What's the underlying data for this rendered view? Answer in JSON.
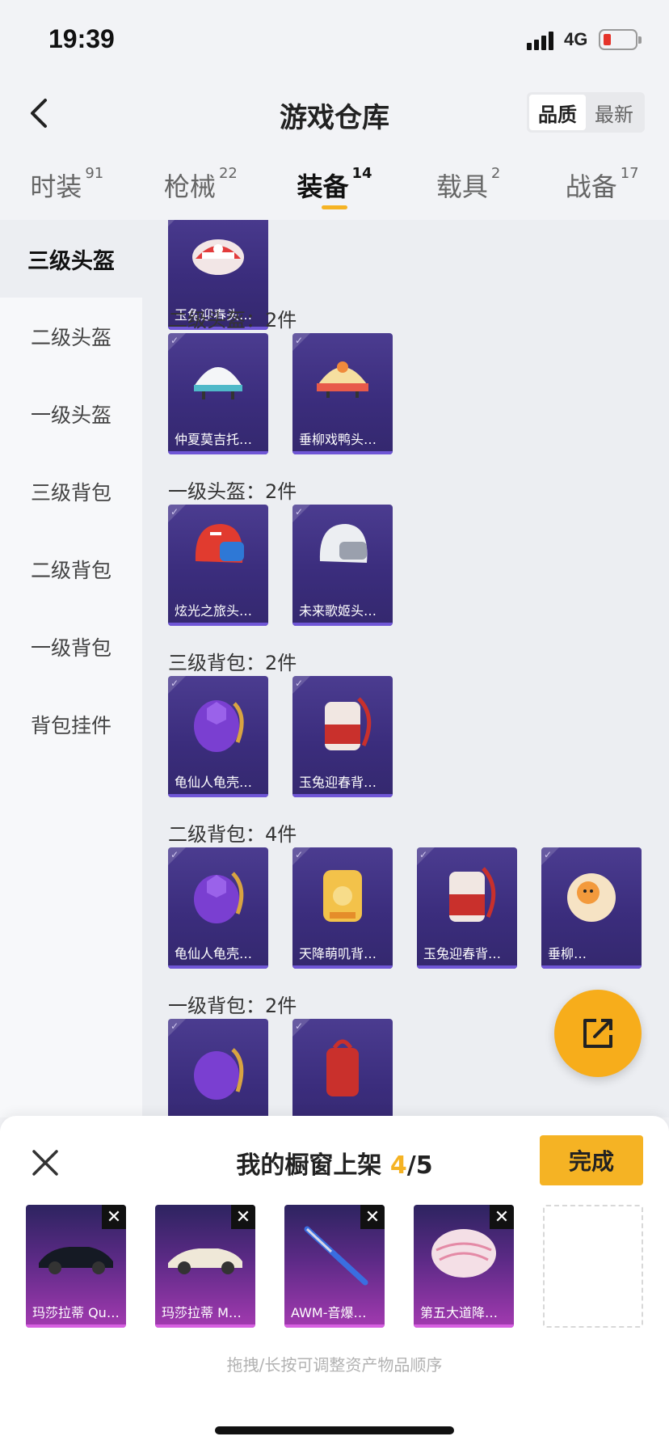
{
  "status": {
    "time": "19:39",
    "network": "4G"
  },
  "header": {
    "title": "游戏仓库",
    "sort": [
      "品质",
      "最新"
    ]
  },
  "tabs": [
    {
      "label": "时装",
      "count": "91"
    },
    {
      "label": "枪械",
      "count": "22"
    },
    {
      "label": "装备",
      "count": "14"
    },
    {
      "label": "载具",
      "count": "2"
    },
    {
      "label": "战备",
      "count": "17"
    }
  ],
  "sidebar": [
    "三级头盔",
    "二级头盔",
    "一级头盔",
    "三级背包",
    "二级背包",
    "一级背包",
    "背包挂件"
  ],
  "sections": [
    {
      "label": "",
      "items": [
        "玉兔迎春头…"
      ]
    },
    {
      "label": "二级头盔：2件",
      "items": [
        "仲夏莫吉托…",
        "垂柳戏鸭头…"
      ]
    },
    {
      "label": "一级头盔：2件",
      "items": [
        "炫光之旅头…",
        "未来歌姬头…"
      ]
    },
    {
      "label": "三级背包：2件",
      "items": [
        "龟仙人龟壳…",
        "玉兔迎春背…"
      ]
    },
    {
      "label": "二级背包：4件",
      "items": [
        "龟仙人龟壳…",
        "天降萌叽背…",
        "玉兔迎春背…",
        "垂柳…"
      ]
    },
    {
      "label": "一级背包：2件",
      "items": [
        "",
        ""
      ]
    }
  ],
  "panel": {
    "title": "我的橱窗上架",
    "count_current": "4",
    "count_total": "/5",
    "done_label": "完成",
    "slots": [
      "玛莎拉蒂 Qu…",
      "玛莎拉蒂 M…",
      "AWM-音爆…",
      "第五大道降…"
    ],
    "hint": "拖拽/长按可调整资产物品顺序"
  },
  "colors": {
    "accent": "#f5b324",
    "card": "#3b2d7d",
    "slot": "#a33ab0"
  }
}
